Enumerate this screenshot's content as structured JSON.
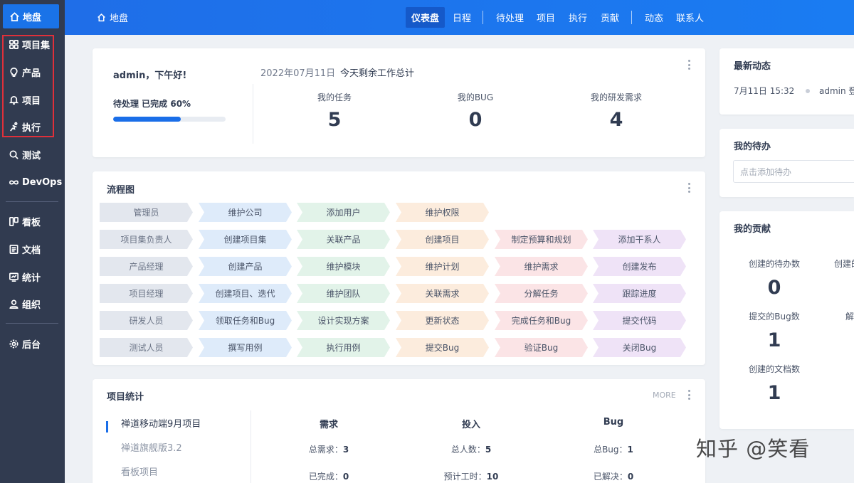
{
  "sidebar": {
    "home": "地盘",
    "items": [
      {
        "label": "项目集",
        "icon": "grid-icon"
      },
      {
        "label": "产品",
        "icon": "bulb-icon"
      },
      {
        "label": "项目",
        "icon": "bell-icon"
      },
      {
        "label": "执行",
        "icon": "run-icon"
      },
      {
        "label": "测试",
        "icon": "search-icon"
      },
      {
        "label": "DevOps",
        "icon": "infinity-icon"
      },
      {
        "label": "看板",
        "icon": "board-icon"
      },
      {
        "label": "文档",
        "icon": "doc-icon"
      },
      {
        "label": "统计",
        "icon": "chart-icon"
      },
      {
        "label": "组织",
        "icon": "user-icon"
      },
      {
        "label": "后台",
        "icon": "gear-icon"
      }
    ]
  },
  "topbar": {
    "home": "地盘",
    "nav": [
      "仪表盘",
      "日程",
      "待处理",
      "项目",
      "执行",
      "贡献",
      "动态",
      "联系人"
    ]
  },
  "welcome": {
    "greeting": "admin，下午好!",
    "pending": "待处理 已完成 60%",
    "progress": 0.6,
    "date": "2022年07月11日",
    "summary": "今天剩余工作总计",
    "stats": [
      {
        "label": "我的任务",
        "value": "5"
      },
      {
        "label": "我的BUG",
        "value": "0"
      },
      {
        "label": "我的研发需求",
        "value": "4"
      }
    ]
  },
  "flow": {
    "title": "流程图",
    "rows": [
      [
        "管理员",
        "维护公司",
        "添加用户",
        "维护权限"
      ],
      [
        "项目集负责人",
        "创建项目集",
        "关联产品",
        "创建项目",
        "制定预算和规划",
        "添加干系人"
      ],
      [
        "产品经理",
        "创建产品",
        "维护模块",
        "维护计划",
        "维护需求",
        "创建发布"
      ],
      [
        "项目经理",
        "创建项目、迭代",
        "维护团队",
        "关联需求",
        "分解任务",
        "跟踪进度"
      ],
      [
        "研发人员",
        "领取任务和Bug",
        "设计实现方案",
        "更新状态",
        "完成任务和Bug",
        "提交代码"
      ],
      [
        "测试人员",
        "撰写用例",
        "执行用例",
        "提交Bug",
        "验证Bug",
        "关闭Bug"
      ]
    ]
  },
  "projects": {
    "title": "项目统计",
    "more": "MORE",
    "list": [
      "禅道移动端9月项目",
      "禅道旗舰版3.2",
      "看板项目"
    ],
    "headers": [
      "需求",
      "投入",
      "Bug"
    ],
    "row1": [
      {
        "label": "总需求：",
        "value": "3"
      },
      {
        "label": "总人数：",
        "value": "5"
      },
      {
        "label": "总Bug：",
        "value": "1"
      }
    ],
    "row2": [
      {
        "label": "已完成：",
        "value": "0"
      },
      {
        "label": "预计工时：",
        "value": "10"
      },
      {
        "label": "已解决：",
        "value": "0"
      }
    ]
  },
  "dynamic": {
    "title": "最新动态",
    "time": "7月11日 15:32",
    "text": "admin 登"
  },
  "todo": {
    "title": "我的待办",
    "placeholder": "点击添加待办"
  },
  "contribution": {
    "title": "我的贡献",
    "items": [
      {
        "label": "创建的待办数",
        "value": "0"
      },
      {
        "label": "创建的",
        "value": ""
      },
      {
        "label": "提交的Bug数",
        "value": "1"
      },
      {
        "label": "解",
        "value": ""
      },
      {
        "label": "创建的文档数",
        "value": "1"
      }
    ]
  },
  "watermark": "知乎 @笑看"
}
